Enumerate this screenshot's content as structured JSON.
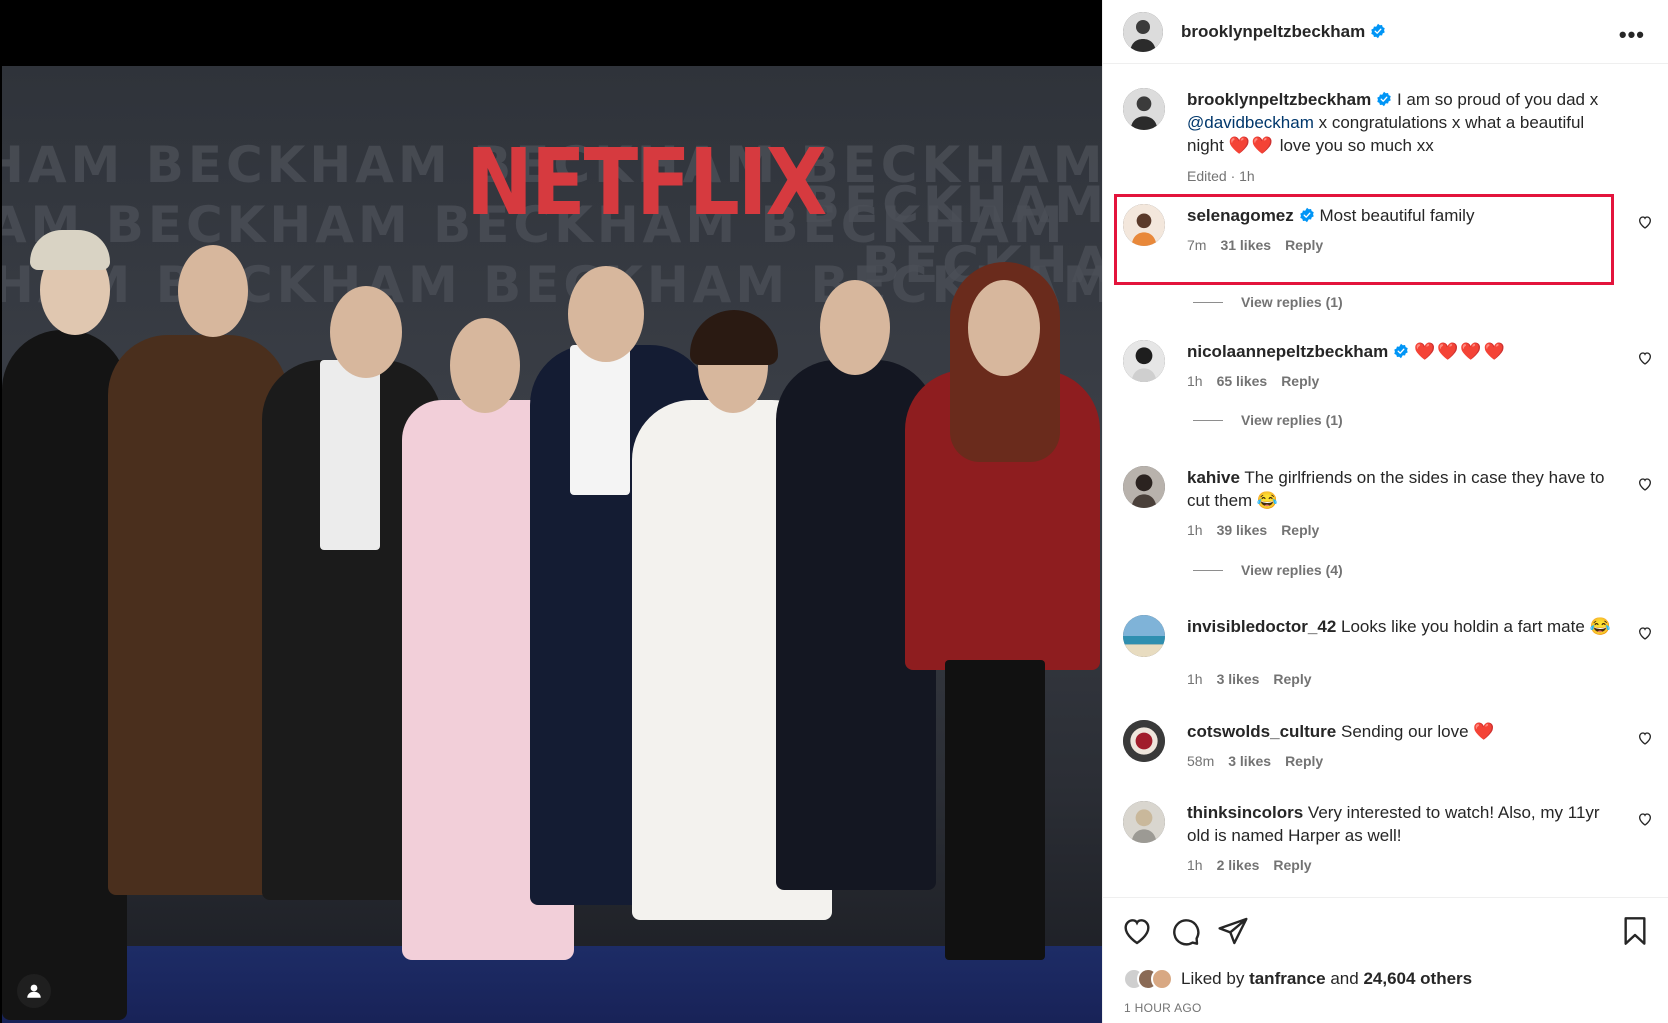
{
  "post": {
    "author": "brooklynpeltzbeckham",
    "caption": {
      "author": "brooklynpeltzbeckham",
      "text_before": "I am so proud of you dad x",
      "mention": "@davidbeckham",
      "text_after": "x congratulations x what a beautiful night",
      "hearts": "❤️❤️",
      "text_end": "love you so much xx",
      "meta": "Edited · 1h"
    },
    "photo": {
      "watermark_text": "BECKHAM",
      "watermark_line": "HAM BECKHAM BECKHAM BECKHAM",
      "brand_text": "NETFLIX"
    }
  },
  "comments": [
    {
      "user": "selenagomez",
      "verified": true,
      "text": "Most beautiful family",
      "time": "7m",
      "likes": "31 likes",
      "reply": "Reply",
      "view_replies": "View replies (1)"
    },
    {
      "user": "nicolaannepeltzbeckham",
      "verified": true,
      "text": "❤️❤️❤️❤️",
      "time": "1h",
      "likes": "65 likes",
      "reply": "Reply",
      "view_replies": "View replies (1)"
    },
    {
      "user": "kahive",
      "verified": false,
      "text": "The girlfriends on the sides in case they have to cut them 😂",
      "time": "1h",
      "likes": "39 likes",
      "reply": "Reply",
      "view_replies": "View replies (4)"
    },
    {
      "user": "invisibledoctor_42",
      "verified": false,
      "text": "Looks like you holdin a fart mate 😂",
      "time": "1h",
      "likes": "3 likes",
      "reply": "Reply"
    },
    {
      "user": "cotswolds_culture",
      "verified": false,
      "text": "Sending our love ❤️",
      "time": "58m",
      "likes": "3 likes",
      "reply": "Reply"
    },
    {
      "user": "thinksincolors",
      "verified": false,
      "text": "Very interested to watch! Also, my 11yr old is named Harper as well!",
      "time": "1h",
      "likes": "2 likes",
      "reply": "Reply"
    }
  ],
  "footer": {
    "liked_by_prefix": "Liked by",
    "liked_by_user": "tanfrance",
    "liked_by_mid": "and",
    "liked_by_count": "24,604 others",
    "time_ago": "1 HOUR AGO"
  },
  "icons": {
    "more": "more-options-icon",
    "like": "heart-icon",
    "comment": "comment-icon",
    "share": "share-icon",
    "save": "bookmark-icon",
    "verified": "verified-badge-icon",
    "user_tag": "user-tag-icon"
  },
  "colors": {
    "verified": "#0095f6",
    "highlight_border": "#e3143c",
    "mention": "#00376b",
    "netflix_red": "#d63a3f"
  }
}
